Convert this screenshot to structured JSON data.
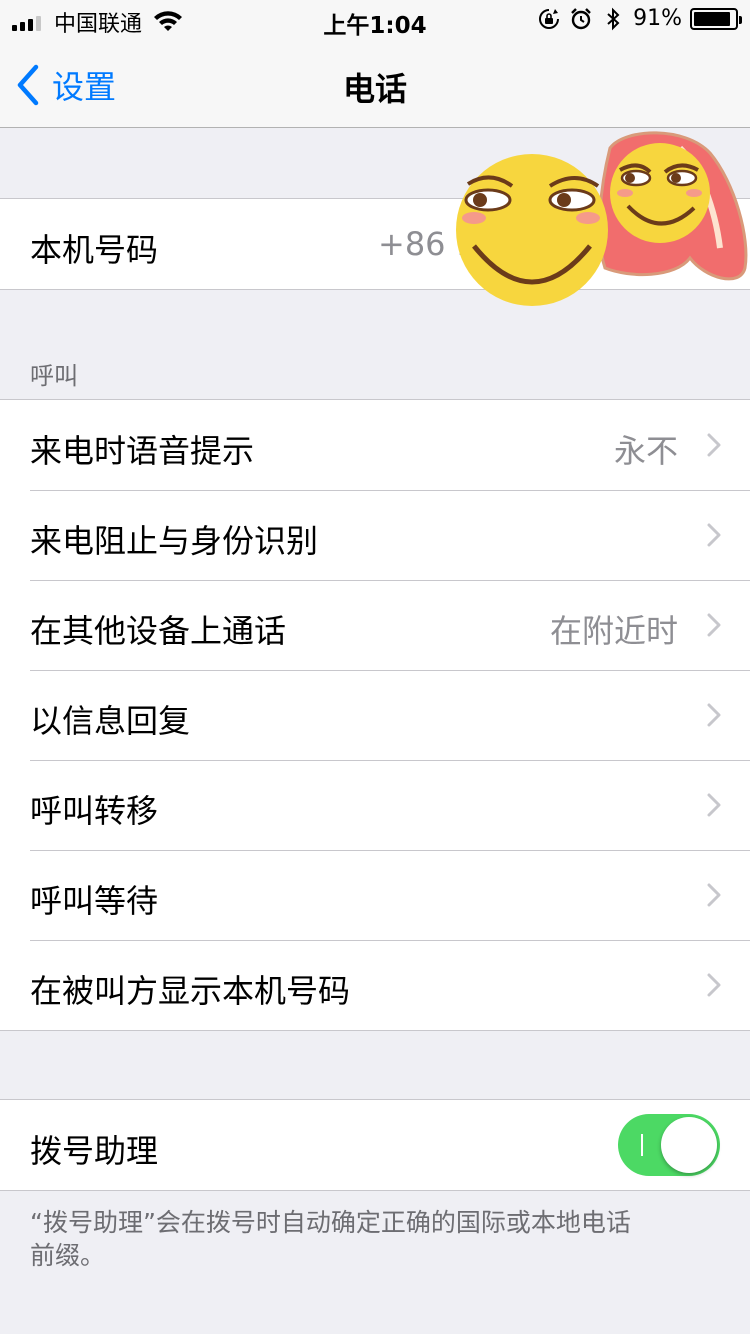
{
  "status_bar": {
    "carrier": "中国联通",
    "time": "上午1:04",
    "battery_percent": "91%",
    "battery_level": 0.91,
    "icons": [
      "signal-icon",
      "wifi-icon",
      "orientation-lock-icon",
      "alarm-icon",
      "bluetooth-icon",
      "battery-icon"
    ]
  },
  "nav": {
    "back_label": "设置",
    "title": "电话"
  },
  "my_number": {
    "label": "本机号码",
    "value": "+86 1"
  },
  "calls_section": {
    "header": "呼叫",
    "rows": [
      {
        "label": "来电时语音提示",
        "value": "永不"
      },
      {
        "label": "来电阻止与身份识别",
        "value": ""
      },
      {
        "label": "在其他设备上通话",
        "value": "在附近时"
      },
      {
        "label": "以信息回复",
        "value": ""
      },
      {
        "label": "呼叫转移",
        "value": ""
      },
      {
        "label": "呼叫等待",
        "value": ""
      },
      {
        "label": "在被叫方显示本机号码",
        "value": ""
      }
    ]
  },
  "dial_assist": {
    "label": "拨号助理",
    "enabled": true,
    "footer": "“拨号助理”会在拨号时自动确定正确的国际或本地电话前缀。"
  },
  "colors": {
    "accent": "#007aff",
    "toggle_on": "#4cd964",
    "background": "#efeff4"
  }
}
